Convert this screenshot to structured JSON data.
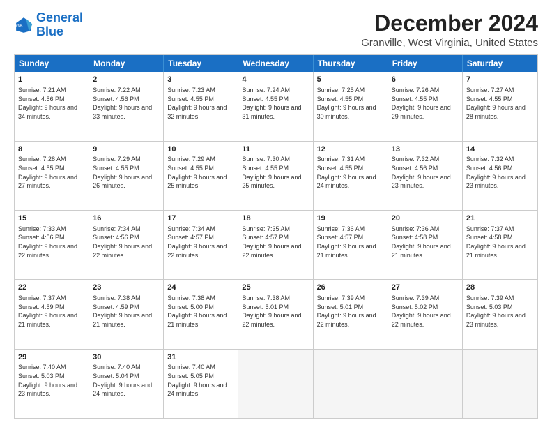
{
  "logo": {
    "line1": "General",
    "line2": "Blue"
  },
  "title": "December 2024",
  "subtitle": "Granville, West Virginia, United States",
  "headers": [
    "Sunday",
    "Monday",
    "Tuesday",
    "Wednesday",
    "Thursday",
    "Friday",
    "Saturday"
  ],
  "weeks": [
    [
      {
        "day": "1",
        "sunrise": "Sunrise: 7:21 AM",
        "sunset": "Sunset: 4:56 PM",
        "daylight": "Daylight: 9 hours and 34 minutes."
      },
      {
        "day": "2",
        "sunrise": "Sunrise: 7:22 AM",
        "sunset": "Sunset: 4:56 PM",
        "daylight": "Daylight: 9 hours and 33 minutes."
      },
      {
        "day": "3",
        "sunrise": "Sunrise: 7:23 AM",
        "sunset": "Sunset: 4:55 PM",
        "daylight": "Daylight: 9 hours and 32 minutes."
      },
      {
        "day": "4",
        "sunrise": "Sunrise: 7:24 AM",
        "sunset": "Sunset: 4:55 PM",
        "daylight": "Daylight: 9 hours and 31 minutes."
      },
      {
        "day": "5",
        "sunrise": "Sunrise: 7:25 AM",
        "sunset": "Sunset: 4:55 PM",
        "daylight": "Daylight: 9 hours and 30 minutes."
      },
      {
        "day": "6",
        "sunrise": "Sunrise: 7:26 AM",
        "sunset": "Sunset: 4:55 PM",
        "daylight": "Daylight: 9 hours and 29 minutes."
      },
      {
        "day": "7",
        "sunrise": "Sunrise: 7:27 AM",
        "sunset": "Sunset: 4:55 PM",
        "daylight": "Daylight: 9 hours and 28 minutes."
      }
    ],
    [
      {
        "day": "8",
        "sunrise": "Sunrise: 7:28 AM",
        "sunset": "Sunset: 4:55 PM",
        "daylight": "Daylight: 9 hours and 27 minutes."
      },
      {
        "day": "9",
        "sunrise": "Sunrise: 7:29 AM",
        "sunset": "Sunset: 4:55 PM",
        "daylight": "Daylight: 9 hours and 26 minutes."
      },
      {
        "day": "10",
        "sunrise": "Sunrise: 7:29 AM",
        "sunset": "Sunset: 4:55 PM",
        "daylight": "Daylight: 9 hours and 25 minutes."
      },
      {
        "day": "11",
        "sunrise": "Sunrise: 7:30 AM",
        "sunset": "Sunset: 4:55 PM",
        "daylight": "Daylight: 9 hours and 25 minutes."
      },
      {
        "day": "12",
        "sunrise": "Sunrise: 7:31 AM",
        "sunset": "Sunset: 4:55 PM",
        "daylight": "Daylight: 9 hours and 24 minutes."
      },
      {
        "day": "13",
        "sunrise": "Sunrise: 7:32 AM",
        "sunset": "Sunset: 4:56 PM",
        "daylight": "Daylight: 9 hours and 23 minutes."
      },
      {
        "day": "14",
        "sunrise": "Sunrise: 7:32 AM",
        "sunset": "Sunset: 4:56 PM",
        "daylight": "Daylight: 9 hours and 23 minutes."
      }
    ],
    [
      {
        "day": "15",
        "sunrise": "Sunrise: 7:33 AM",
        "sunset": "Sunset: 4:56 PM",
        "daylight": "Daylight: 9 hours and 22 minutes."
      },
      {
        "day": "16",
        "sunrise": "Sunrise: 7:34 AM",
        "sunset": "Sunset: 4:56 PM",
        "daylight": "Daylight: 9 hours and 22 minutes."
      },
      {
        "day": "17",
        "sunrise": "Sunrise: 7:34 AM",
        "sunset": "Sunset: 4:57 PM",
        "daylight": "Daylight: 9 hours and 22 minutes."
      },
      {
        "day": "18",
        "sunrise": "Sunrise: 7:35 AM",
        "sunset": "Sunset: 4:57 PM",
        "daylight": "Daylight: 9 hours and 22 minutes."
      },
      {
        "day": "19",
        "sunrise": "Sunrise: 7:36 AM",
        "sunset": "Sunset: 4:57 PM",
        "daylight": "Daylight: 9 hours and 21 minutes."
      },
      {
        "day": "20",
        "sunrise": "Sunrise: 7:36 AM",
        "sunset": "Sunset: 4:58 PM",
        "daylight": "Daylight: 9 hours and 21 minutes."
      },
      {
        "day": "21",
        "sunrise": "Sunrise: 7:37 AM",
        "sunset": "Sunset: 4:58 PM",
        "daylight": "Daylight: 9 hours and 21 minutes."
      }
    ],
    [
      {
        "day": "22",
        "sunrise": "Sunrise: 7:37 AM",
        "sunset": "Sunset: 4:59 PM",
        "daylight": "Daylight: 9 hours and 21 minutes."
      },
      {
        "day": "23",
        "sunrise": "Sunrise: 7:38 AM",
        "sunset": "Sunset: 4:59 PM",
        "daylight": "Daylight: 9 hours and 21 minutes."
      },
      {
        "day": "24",
        "sunrise": "Sunrise: 7:38 AM",
        "sunset": "Sunset: 5:00 PM",
        "daylight": "Daylight: 9 hours and 21 minutes."
      },
      {
        "day": "25",
        "sunrise": "Sunrise: 7:38 AM",
        "sunset": "Sunset: 5:01 PM",
        "daylight": "Daylight: 9 hours and 22 minutes."
      },
      {
        "day": "26",
        "sunrise": "Sunrise: 7:39 AM",
        "sunset": "Sunset: 5:01 PM",
        "daylight": "Daylight: 9 hours and 22 minutes."
      },
      {
        "day": "27",
        "sunrise": "Sunrise: 7:39 AM",
        "sunset": "Sunset: 5:02 PM",
        "daylight": "Daylight: 9 hours and 22 minutes."
      },
      {
        "day": "28",
        "sunrise": "Sunrise: 7:39 AM",
        "sunset": "Sunset: 5:03 PM",
        "daylight": "Daylight: 9 hours and 23 minutes."
      }
    ],
    [
      {
        "day": "29",
        "sunrise": "Sunrise: 7:40 AM",
        "sunset": "Sunset: 5:03 PM",
        "daylight": "Daylight: 9 hours and 23 minutes."
      },
      {
        "day": "30",
        "sunrise": "Sunrise: 7:40 AM",
        "sunset": "Sunset: 5:04 PM",
        "daylight": "Daylight: 9 hours and 24 minutes."
      },
      {
        "day": "31",
        "sunrise": "Sunrise: 7:40 AM",
        "sunset": "Sunset: 5:05 PM",
        "daylight": "Daylight: 9 hours and 24 minutes."
      },
      null,
      null,
      null,
      null
    ]
  ]
}
